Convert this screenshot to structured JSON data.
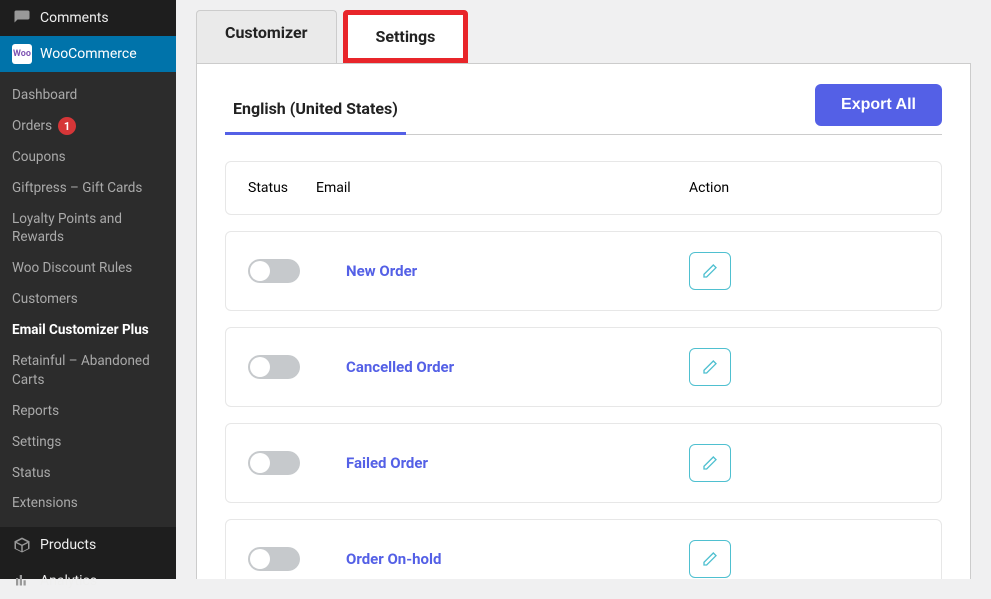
{
  "sidebar": {
    "comments": "Comments",
    "woocommerce": "WooCommerce",
    "woo_icon_text": "Woo",
    "products": "Products",
    "analytics": "Analytics",
    "submenu": {
      "dashboard": "Dashboard",
      "orders": "Orders",
      "orders_badge": "1",
      "coupons": "Coupons",
      "giftpress": "Giftpress – Gift Cards",
      "loyalty": "Loyalty Points and Rewards",
      "discount": "Woo Discount Rules",
      "customers": "Customers",
      "email_customizer": "Email Customizer Plus",
      "retainful": "Retainful – Abandoned Carts",
      "reports": "Reports",
      "settings": "Settings",
      "status": "Status",
      "extensions": "Extensions"
    }
  },
  "tabs": {
    "customizer": "Customizer",
    "settings": "Settings"
  },
  "subtab": {
    "english": "English (United States)"
  },
  "export_button": "Export All",
  "table": {
    "status_header": "Status",
    "email_header": "Email",
    "action_header": "Action"
  },
  "emails": [
    {
      "name": "New Order"
    },
    {
      "name": "Cancelled Order"
    },
    {
      "name": "Failed Order"
    },
    {
      "name": "Order On-hold"
    }
  ],
  "colors": {
    "accent": "#5460e6",
    "highlight_border": "#e8252a",
    "teal": "#4fc0d0"
  }
}
